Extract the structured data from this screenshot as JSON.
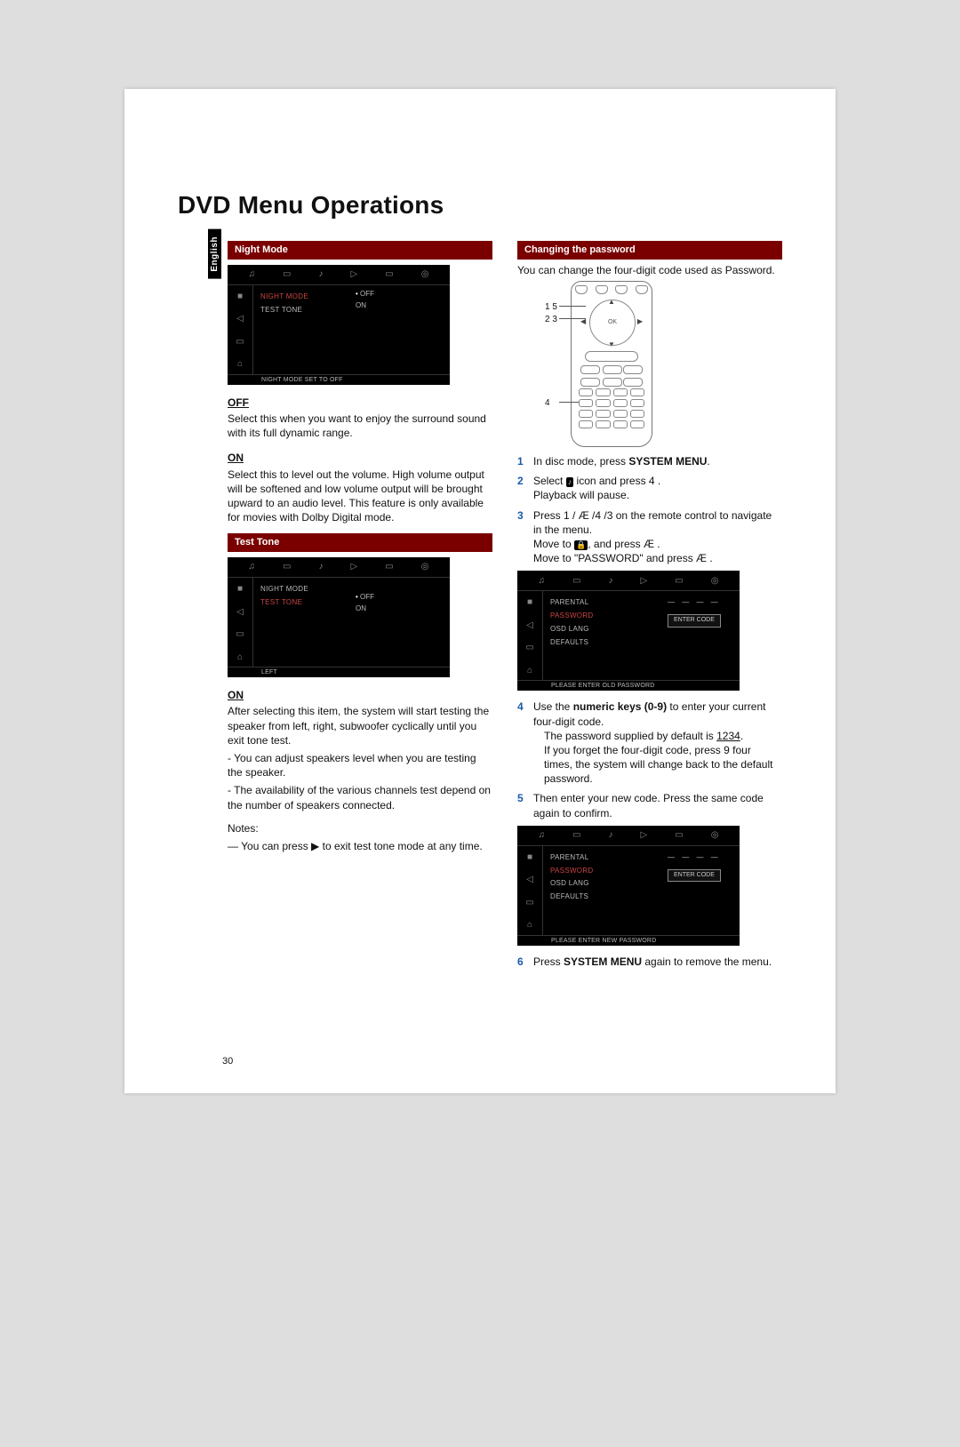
{
  "page": {
    "title": "DVD Menu Operations",
    "language_tab": "English",
    "page_number": "30"
  },
  "left": {
    "night_mode_header": "Night Mode",
    "night_screen": {
      "menu_items": [
        "NIGHT MODE",
        "TEST TONE"
      ],
      "selected": "NIGHT MODE",
      "options": [
        "OFF",
        "ON"
      ],
      "status": "NIGHT MODE SET TO OFF"
    },
    "off_head": "OFF",
    "off_text": "Select this when you want to enjoy the surround sound with its full dynamic range.",
    "on_head": "ON",
    "on_text": "Select this to level out the volume. High volume output will be softened and low volume output will be brought upward to an audio level. This feature is only available for movies with Dolby Digital mode.",
    "test_tone_header": "Test Tone",
    "test_screen": {
      "menu_items": [
        "NIGHT MODE",
        "TEST TONE"
      ],
      "selected": "TEST TONE",
      "options": [
        "OFF",
        "ON"
      ],
      "status": "LEFT"
    },
    "tt_on_head": "ON",
    "tt_on_p1": "After selecting this item, the system will start testing the speaker from left, right, subwoofer cyclically until you exit tone test.",
    "tt_on_p2": " - You can adjust speakers level when you are testing the speaker.",
    "tt_on_p3": " - The availability of the various channels test depend on the number of speakers connected.",
    "notes_head": "Notes:",
    "notes_text": "— You can press ▶ to exit test tone mode at any time."
  },
  "right": {
    "header": "Changing the password",
    "intro": "You can change the four-digit code used as Password.",
    "remote_labels": {
      "l1": "1 5",
      "l2": "2 3",
      "l4": "4",
      "ok": "OK"
    },
    "step1_a": "In disc mode, press ",
    "step1_b": "SYSTEM MENU",
    "step1_c": ".",
    "step2_a": "Select ",
    "step2_b": " icon and press ",
    "step2_c": "4",
    "step2_d": " .",
    "step2_e": "Playback will pause.",
    "step3_a": "Press ",
    "step3_b": "1",
    "step3_c": " / Æ /",
    "step3_d": "4",
    "step3_e": " /",
    "step3_f": "3",
    "step3_g": " on the remote control to navigate in the menu.",
    "step3_h": "Move to ",
    "step3_i": ", and press Æ .",
    "step3_j": "Move to \"PASSWORD\" and press Æ .",
    "screen_a": {
      "menu_items": [
        "PARENTAL",
        "PASSWORD",
        "OSD LANG",
        "DEFAULTS"
      ],
      "enter_label": "ENTER CODE",
      "status": "PLEASE ENTER OLD PASSWORD"
    },
    "step4_a": "Use the ",
    "step4_b": "numeric keys (0-9)",
    "step4_c": " to enter your current four-digit code.",
    "step4_note1a": "The password supplied by default is ",
    "step4_note1b": "1234",
    "step4_note1c": ".",
    "step4_note2a": "If you forget the four-digit code, press ",
    "step4_note2b": "9",
    "step4_note2c": " four times, the system will change back to the default password.",
    "step5": "Then enter your new code. Press the same code again to confirm.",
    "screen_b": {
      "menu_items": [
        "PARENTAL",
        "PASSWORD",
        "OSD LANG",
        "DEFAULTS"
      ],
      "enter_label": "ENTER CODE",
      "status": "PLEASE ENTER NEW PASSWORD"
    },
    "step6_a": "Press ",
    "step6_b": "SYSTEM MENU",
    "step6_c": " again to remove the menu."
  },
  "icons": {
    "tab1": "♫",
    "tab2": "▭",
    "tab3": "♪",
    "tab4": "▷",
    "tab5": "▭",
    "tab6": "◎",
    "side1": "■",
    "side2": "◁",
    "side3": "▭",
    "side4": "⌂",
    "stop": "■",
    "lock": "🔒"
  }
}
